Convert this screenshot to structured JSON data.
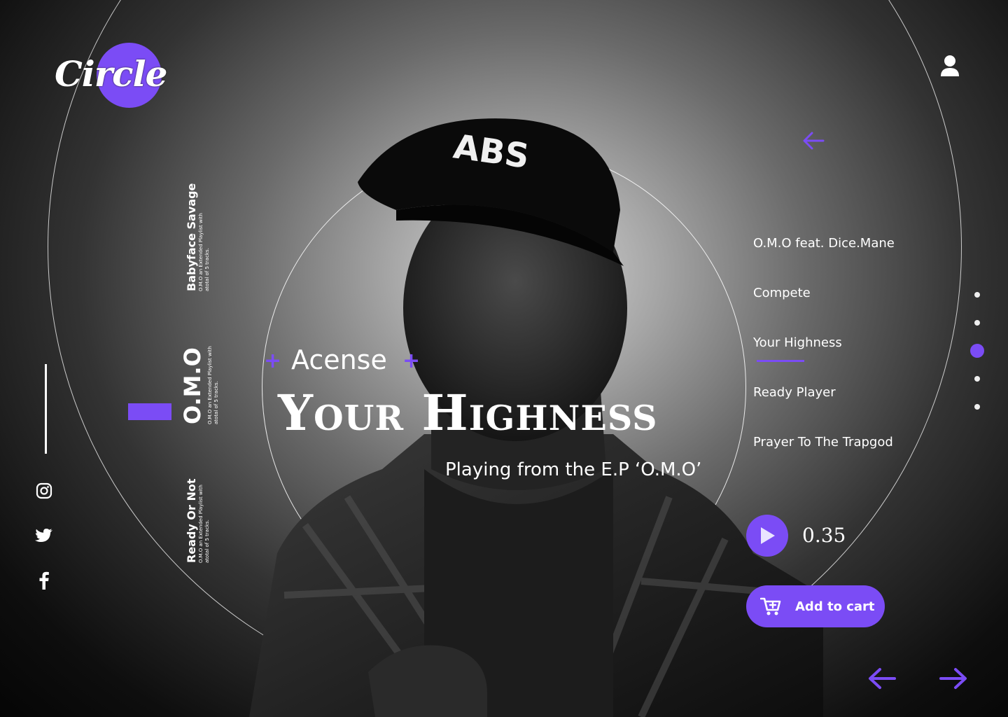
{
  "brand": {
    "logo_text": "Circle"
  },
  "albums": [
    {
      "title": "Babyface Savage",
      "description": "O.M.O an Extended Playlist with atotal of 5 tracks."
    },
    {
      "title": "O.M.O",
      "description": "O.M.O an Extended Playlist with atotal of 5 tracks."
    },
    {
      "title": "Ready Or Not",
      "description": "O.M.O an Extended Playlist with atotal of 5 tracks."
    }
  ],
  "now_playing": {
    "artist": "Acense",
    "title": "Your Highness",
    "subtitle": "Playing from the E.P ‘O.M.O’",
    "time": "0.35"
  },
  "tracklist": [
    "O.M.O feat. Dice.Mane",
    "Compete",
    "Your Highness",
    "Ready Player",
    "Prayer To The Trapgod"
  ],
  "active_track_index": 2,
  "pager": {
    "count": 5,
    "active": 2
  },
  "cart": {
    "label": "Add to cart"
  },
  "icons": {
    "user": "user-icon",
    "back": "arrow-left-icon",
    "social": [
      "instagram-icon",
      "twitter-icon",
      "facebook-icon"
    ],
    "play": "play-icon",
    "cart": "cart-plus-icon",
    "prev": "arrow-left-icon",
    "next": "arrow-right-icon"
  },
  "colors": {
    "accent": "#7b4cf5",
    "text": "#ffffff"
  }
}
